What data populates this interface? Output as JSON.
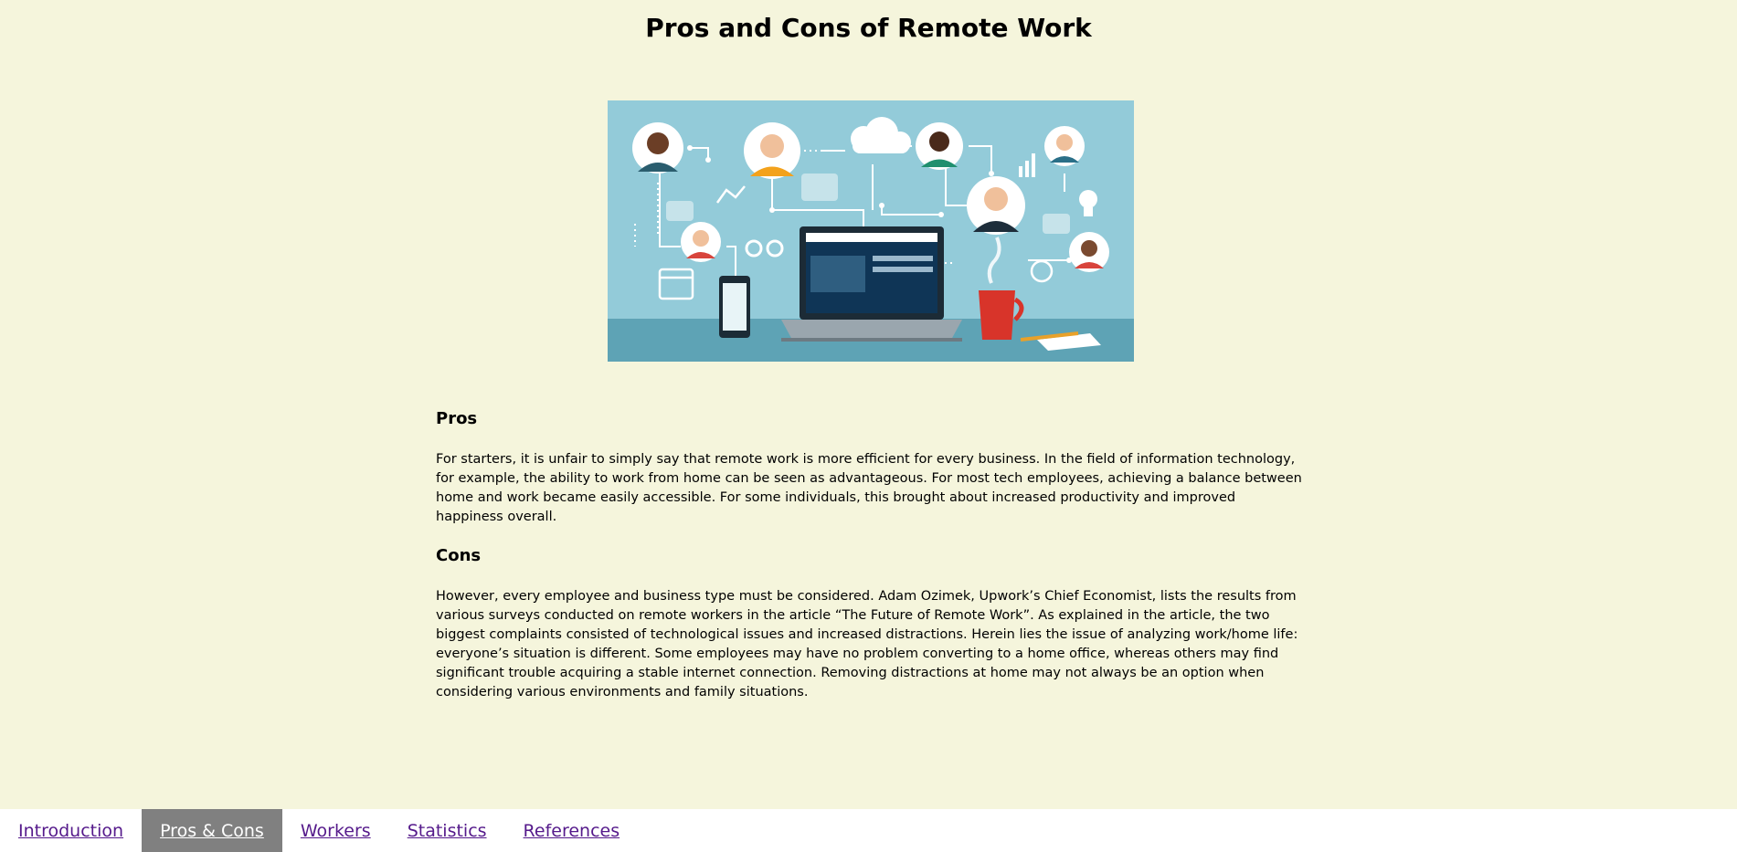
{
  "page": {
    "title": "Pros and Cons of Remote Work"
  },
  "hero": {
    "illustration": "remote-work-network-illustration"
  },
  "sections": [
    {
      "heading": "Pros",
      "body": "For starters, it is unfair to simply say that remote work is more efficient for every business. In the field of information technology, for example, the ability to work from home can be seen as advantageous. For most tech employees, achieving a balance between home and work became easily accessible. For some individuals, this brought about increased productivity and improved happiness overall."
    },
    {
      "heading": "Cons",
      "body": "However, every employee and business type must be considered. Adam Ozimek, Upwork’s Chief Economist, lists the results from various surveys conducted on remote workers in the article “The Future of Remote Work”. As explained in the article, the two biggest complaints consisted of technological issues and increased distractions. Herein lies the issue of analyzing work/home life: everyone’s situation is different. Some employees may have no problem converting to a home office, whereas others may find significant trouble acquiring a stable internet connection. Removing distractions at home may not always be an option when considering various environments and family situations."
    }
  ],
  "nav": {
    "items": [
      {
        "label": "Introduction",
        "active": false
      },
      {
        "label": "Pros & Cons",
        "active": true
      },
      {
        "label": "Workers",
        "active": false
      },
      {
        "label": "Statistics",
        "active": false
      },
      {
        "label": "References",
        "active": false
      }
    ]
  },
  "colors": {
    "background": "#f5f5dc",
    "nav_background": "#ffffff",
    "nav_active": "#808080",
    "link": "#551a8b",
    "hero_sky": "#93cbd9"
  }
}
